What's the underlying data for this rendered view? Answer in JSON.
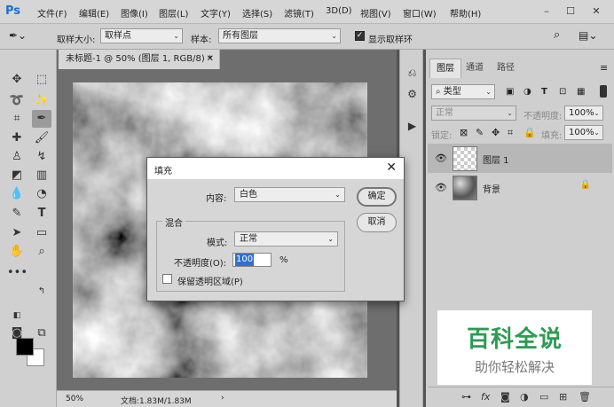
{
  "app": {
    "logo": "Ps"
  },
  "menu": [
    "文件(F)",
    "编辑(E)",
    "图像(I)",
    "图层(L)",
    "文字(Y)",
    "选择(S)",
    "滤镜(T)",
    "3D(D)",
    "视图(V)",
    "窗口(W)",
    "帮助(H)"
  ],
  "options": {
    "sample_size_label": "取样大小:",
    "sample_size_value": "取样点",
    "sample_label": "样本:",
    "sample_value": "所有图层",
    "show_ring_label": "显示取样环"
  },
  "document": {
    "tab_title": "未标题-1 @ 50% (图层 1, RGB/8) *",
    "zoom": "50%",
    "doc_info": "文档:1.83M/1.83M"
  },
  "layers_panel": {
    "tabs": [
      "图层",
      "通道",
      "路径"
    ],
    "filter_kind": "类型",
    "blend_mode": "正常",
    "opacity_label": "不透明度:",
    "opacity_value": "100%",
    "lock_label": "锁定:",
    "fill_label": "填充:",
    "fill_value": "100%",
    "layers": [
      {
        "name": "图层 1"
      },
      {
        "name": "背景"
      }
    ]
  },
  "watermark": {
    "title": "百科全说",
    "subtitle": "助你轻松解决"
  },
  "dialog": {
    "title": "填充",
    "content_label": "内容:",
    "content_value": "白色",
    "ok_button": "确定",
    "cancel_button": "取消",
    "blend_group_label": "混合",
    "mode_label": "模式:",
    "mode_value": "正常",
    "opacity_label": "不透明度(O):",
    "opacity_value": "100",
    "opacity_unit": "%",
    "preserve_transparency_label": "保留透明区域(P)"
  },
  "colors": {
    "foreground": "#000000",
    "background": "#ffffff",
    "accent": "#1c6fd0",
    "watermark_green": "#2d9b53"
  }
}
